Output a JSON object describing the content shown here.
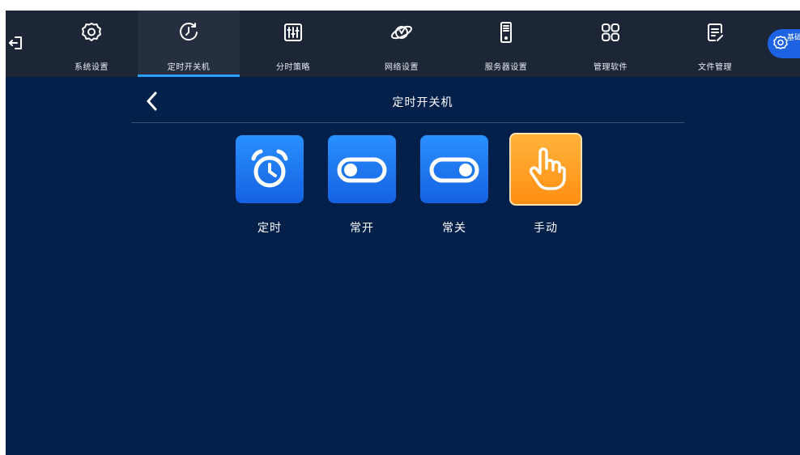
{
  "nav": {
    "items": [
      {
        "label": "系统设置",
        "icon": "gear-icon"
      },
      {
        "label": "定时开关机",
        "icon": "clock-refresh-icon"
      },
      {
        "label": "分时策略",
        "icon": "sliders-icon"
      },
      {
        "label": "网络设置",
        "icon": "planet-icon"
      },
      {
        "label": "服务器设置",
        "icon": "server-icon"
      },
      {
        "label": "管理软件",
        "icon": "apps-grid-icon"
      },
      {
        "label": "文件管理",
        "icon": "document-edit-icon"
      }
    ],
    "active_index": 1,
    "basic_settings_label": "基础设置"
  },
  "page": {
    "title": "定时开关机"
  },
  "modes": [
    {
      "label": "定时",
      "icon": "alarm-clock-icon",
      "color": "#1a73f0"
    },
    {
      "label": "常开",
      "icon": "toggle-off-icon",
      "color": "#1a73f0"
    },
    {
      "label": "常关",
      "icon": "toggle-on-icon",
      "color": "#1a73f0"
    },
    {
      "label": "手动",
      "icon": "hand-pointer-icon",
      "color": "#ff9a1f",
      "selected": true
    }
  ],
  "colors": {
    "background": "#03204a",
    "topbar": "#1d2636",
    "accent": "#2ea0ff"
  }
}
